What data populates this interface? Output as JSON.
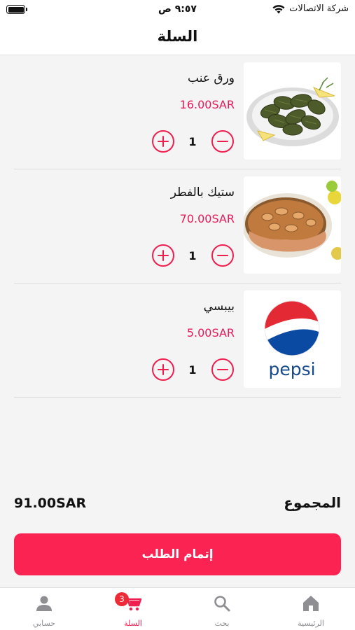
{
  "status_bar": {
    "carrier": "شركة الاتصالات",
    "time": "٩:٥٧ ص"
  },
  "header": {
    "title": "السلة"
  },
  "cart": {
    "currency": "SAR",
    "items": [
      {
        "name": "ورق عنب",
        "price": "16.00SAR",
        "quantity": "1",
        "image": "grape-leaves-image"
      },
      {
        "name": "ستيك بالفطر",
        "price": "70.00SAR",
        "quantity": "1",
        "image": "mushroom-steak-image"
      },
      {
        "name": "بيبسي",
        "price": "5.00SAR",
        "quantity": "1",
        "image": "pepsi-logo",
        "image_text": "pepsi"
      }
    ],
    "total_label": "المجموع",
    "total_value": "91.00SAR",
    "checkout_label": "إتمام الطلب"
  },
  "tabbar": {
    "tabs": [
      {
        "label": "الرئيسية",
        "icon": "home-icon"
      },
      {
        "label": "بحث",
        "icon": "search-icon"
      },
      {
        "label": "السلة",
        "icon": "cart-icon",
        "badge": "3",
        "active": true
      },
      {
        "label": "حسابي",
        "icon": "user-icon"
      }
    ]
  },
  "colors": {
    "accent": "#fb2352",
    "price": "#e8195a",
    "background": "#f4f4f4",
    "badge": "#ee2a36"
  }
}
